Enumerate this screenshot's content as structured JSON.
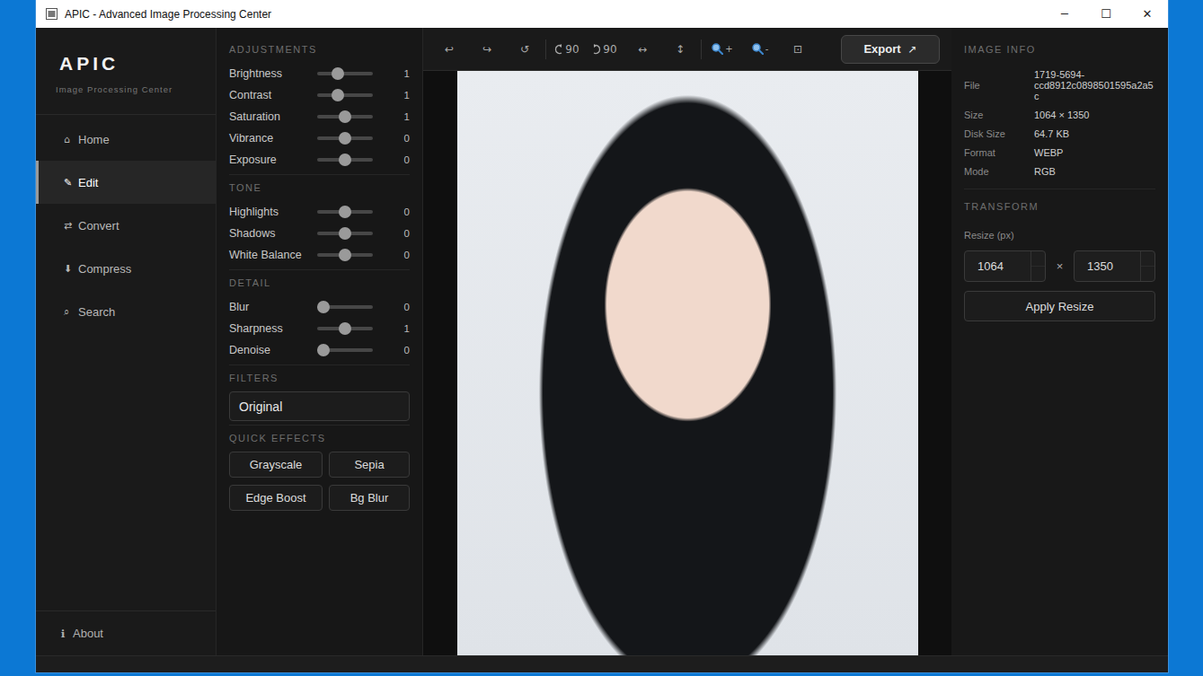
{
  "window": {
    "title": "APIC - Advanced Image Processing Center",
    "controls": [
      "─",
      "☐",
      "✕"
    ]
  },
  "sidebar": {
    "logo": "APIC",
    "subtitle": "Image Processing Center",
    "items": [
      {
        "icon": "⌂",
        "label": "Home",
        "selected": false
      },
      {
        "icon": "✎",
        "label": "Edit",
        "selected": true
      },
      {
        "icon": "⇄",
        "label": "Convert",
        "selected": false
      },
      {
        "icon": "⬇",
        "label": "Compress",
        "selected": false
      },
      {
        "icon": "⌕",
        "label": "Search",
        "selected": false
      }
    ],
    "footer": {
      "icon": "ℹ",
      "label": "About"
    }
  },
  "adjustments": {
    "sections": [
      {
        "title": "ADJUSTMENTS",
        "sliders": [
          {
            "label": "Brightness",
            "level": 0.33,
            "value": "1"
          },
          {
            "label": "Contrast",
            "level": 0.33,
            "value": "1"
          },
          {
            "label": "Saturation",
            "level": 0.5,
            "value": "1"
          },
          {
            "label": "Vibrance",
            "level": 0.5,
            "value": "0"
          },
          {
            "label": "Exposure",
            "level": 0.5,
            "value": "0"
          }
        ]
      },
      {
        "title": "TONE",
        "sliders": [
          {
            "label": "Highlights",
            "level": 0.5,
            "value": "0"
          },
          {
            "label": "Shadows",
            "level": 0.5,
            "value": "0"
          },
          {
            "label": "White Balance",
            "level": 0.5,
            "value": "0"
          }
        ]
      },
      {
        "title": "DETAIL",
        "sliders": [
          {
            "label": "Blur",
            "level": 0,
            "value": "0"
          },
          {
            "label": "Sharpness",
            "level": 0.5,
            "value": "1"
          },
          {
            "label": "Denoise",
            "level": 0,
            "value": "0"
          }
        ]
      }
    ],
    "filters": {
      "title": "FILTERS",
      "value": "Original"
    },
    "quick_effects": {
      "title": "QUICK EFFECTS",
      "buttons": [
        "Grayscale",
        "Sepia",
        "Edge Boost",
        "Bg Blur"
      ]
    }
  },
  "toolbar": {
    "groups": [
      [
        {
          "kind": "glyph",
          "label": "↩"
        },
        {
          "kind": "glyph",
          "label": "↪"
        },
        {
          "kind": "glyph",
          "label": "↺"
        }
      ],
      [
        {
          "kind": "rotate-left",
          "label": "90"
        },
        {
          "kind": "rotate-right",
          "label": "90"
        },
        {
          "kind": "glyph",
          "label": "↔"
        },
        {
          "kind": "glyph",
          "label": "↕"
        }
      ],
      [
        {
          "kind": "zoom",
          "label": "+"
        },
        {
          "kind": "zoom",
          "label": "-"
        },
        {
          "kind": "glyph",
          "label": "⊡"
        }
      ]
    ],
    "export": {
      "label": "Export",
      "icon": "↗"
    }
  },
  "info": {
    "title": "IMAGE INFO",
    "rows": [
      {
        "label": "File",
        "value": "1719-5694-ccd8912c0898501595a2a5c"
      },
      {
        "label": "Size",
        "value": "1064 × 1350"
      },
      {
        "label": "Disk Size",
        "value": "64.7 KB"
      },
      {
        "label": "Format",
        "value": "WEBP"
      },
      {
        "label": "Mode",
        "value": "RGB"
      }
    ],
    "transform": {
      "title": "TRANSFORM",
      "resize_label": "Resize (px)",
      "width": "1064",
      "separator": "×",
      "height": "1350",
      "apply": "Apply Resize"
    }
  }
}
